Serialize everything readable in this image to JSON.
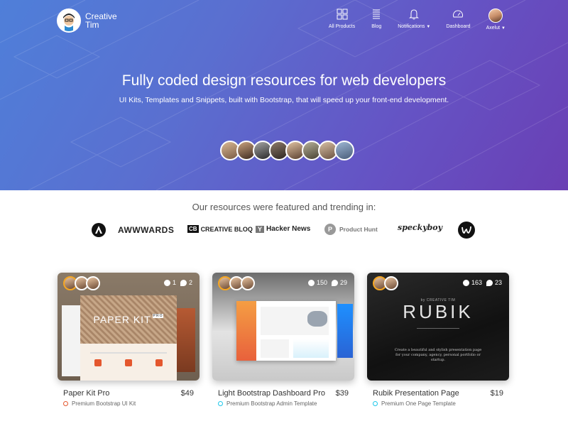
{
  "header": {
    "brand": "Creative Tim",
    "nav": [
      {
        "label": "All Products",
        "icon": "grid-icon"
      },
      {
        "label": "Blog",
        "icon": "list-icon"
      },
      {
        "label": "Notifications",
        "icon": "bell-icon",
        "dropdown": true
      },
      {
        "label": "Dashboard",
        "icon": "gauge-icon"
      },
      {
        "label": "Axelut",
        "icon": "avatar",
        "dropdown": true
      }
    ]
  },
  "hero": {
    "title": "Fully coded design resources for web developers",
    "subtitle": "UI Kits, Templates and Snippets, built with Bootstrap, that will speed up your front-end development."
  },
  "featured": {
    "title": "Our resources were featured and trending in:",
    "logos": [
      "AWWWARDS",
      "CREATIVE BLOQ",
      "Hacker News",
      "Product Hunt",
      "speckyboy"
    ]
  },
  "products": [
    {
      "name": "Paper Kit Pro",
      "price": "$49",
      "category": "Premium Bootstrap UI Kit",
      "downloads": "1",
      "comments": "2",
      "preview_title": "PAPER KIT",
      "preview_badge": "PRO",
      "dot_color": "#e4572e"
    },
    {
      "name": "Light Bootstrap Dashboard Pro",
      "price": "$39",
      "category": "Premium Bootstrap Admin Template",
      "downloads": "150",
      "comments": "29",
      "dot_color": "#1dc7ea"
    },
    {
      "name": "Rubik Presentation Page",
      "price": "$19",
      "category": "Premium One Page Template",
      "downloads": "163",
      "comments": "23",
      "preview_title": "RUBIK",
      "preview_eyebrow": "by CREATIVE TIM",
      "preview_text": "Create a beautiful and stylish presentation page for your company, agency, personal portfolio or startup.",
      "dot_color": "#1dc7ea"
    }
  ]
}
